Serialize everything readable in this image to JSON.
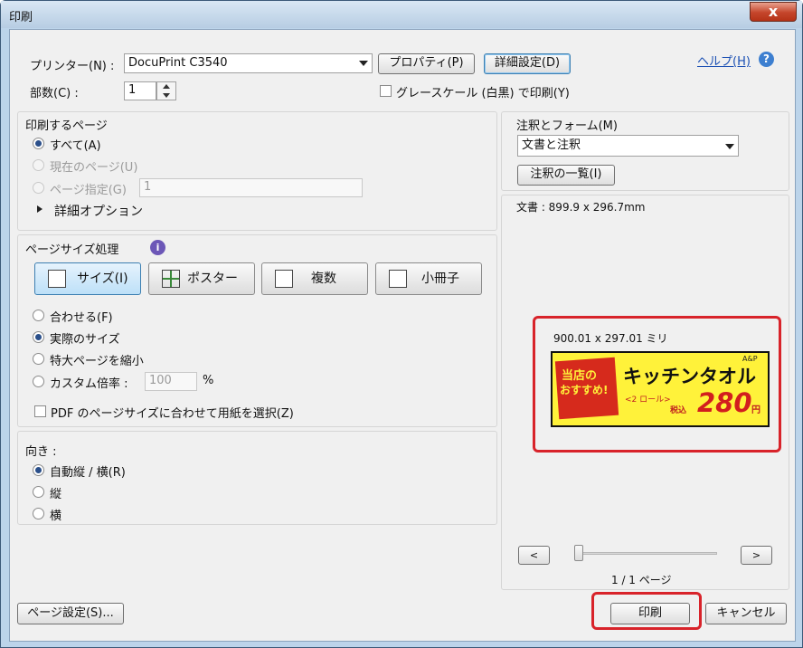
{
  "window": {
    "title": "印刷",
    "close_glyph": "x"
  },
  "printer": {
    "label": "プリンター(N) :",
    "value": "DocuPrint C3540",
    "properties_button": "プロパティ(P)",
    "advanced_button": "詳細設定(D)",
    "help_link": "ヘルプ(H)",
    "help_icon": "?"
  },
  "copies": {
    "label": "部数(C) :",
    "value": "1"
  },
  "grayscale": {
    "label": "グレースケール (白黒) で印刷(Y)",
    "checked": false
  },
  "pages": {
    "title": "印刷するページ",
    "all": "すべて(A)",
    "current": "現在のページ(U)",
    "range": "ページ指定(G)",
    "range_value": "1",
    "more_options": "詳細オプション"
  },
  "sizing": {
    "title": "ページサイズ処理",
    "info_icon": "i",
    "buttons": [
      "サイズ(I)",
      "ポスター",
      "複数",
      "小冊子"
    ],
    "fit": "合わせる(F)",
    "actual": "実際のサイズ",
    "shrink": "特大ページを縮小",
    "custom": "カスタム倍率 :",
    "custom_value": "100",
    "percent": "%",
    "pdf_paper": "PDF のページサイズに合わせて用紙を選択(Z)"
  },
  "orientation": {
    "title": "向き :",
    "auto": "自動縦 / 横(R)",
    "portrait": "縦",
    "landscape": "横"
  },
  "comments": {
    "title": "注釈とフォーム(M)",
    "value": "文書と注釈",
    "summary_button": "注釈の一覧(I)"
  },
  "preview": {
    "doc_size": "文書 : 899.9 x 296.7mm",
    "paper_size": "900.01 x 297.01 ミリ",
    "banner_left": [
      "当店の",
      "おすすめ!"
    ],
    "banner_title": "キッチンタオル",
    "banner_brand": "A&P",
    "banner_sub": "<2 ロール>",
    "banner_tax": "税込",
    "banner_price": "280",
    "banner_yen": "円",
    "prev": "<",
    "next": ">",
    "page_info": "1 / 1 ページ"
  },
  "footer": {
    "page_setup": "ページ設定(S)...",
    "print": "印刷",
    "cancel": "キャンセル"
  }
}
